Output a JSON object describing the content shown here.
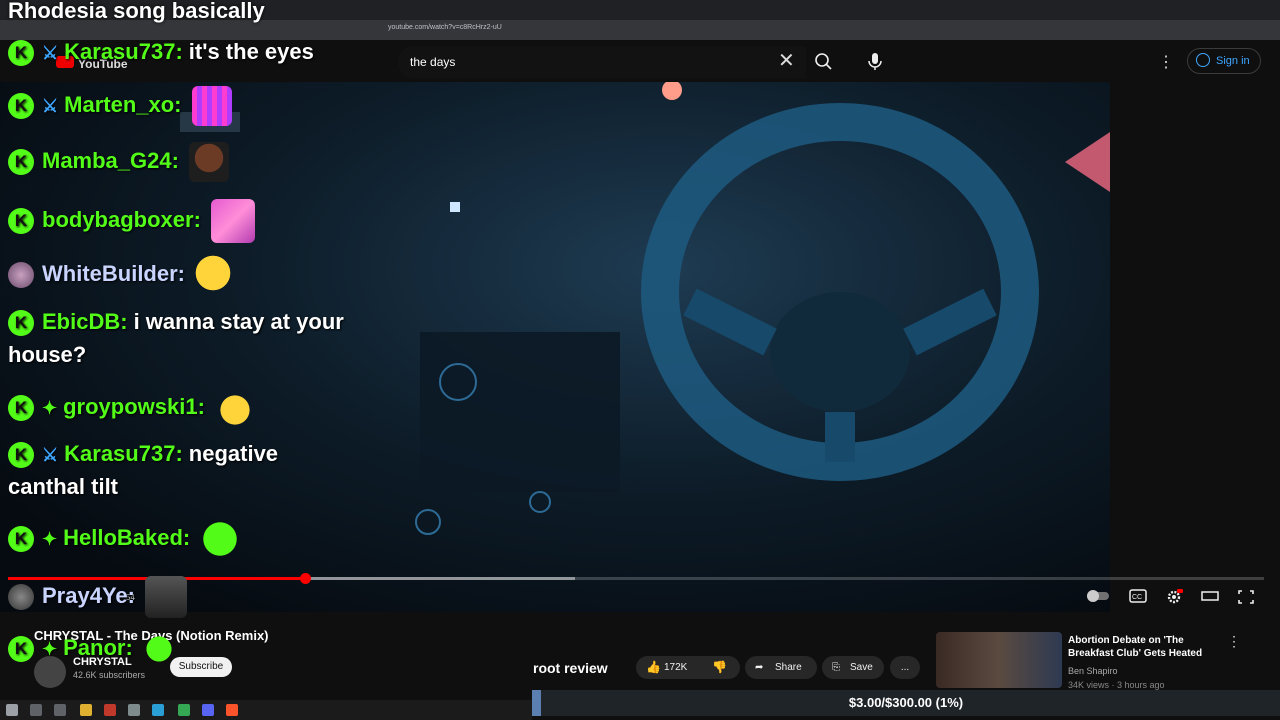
{
  "stream_title": "Rhodesia song basically",
  "browser": {
    "url": "youtube.com/watch?v=c8RcHrz2-uU"
  },
  "youtube": {
    "logo_text": "YouTube",
    "search_value": "the days",
    "signin_label": "Sign in",
    "video": {
      "title": "CHRYSTAL - The Days (Notion Remix)",
      "channel": "CHRYSTAL",
      "subscribers": "42.6K subscribers",
      "subscribe_label": "Subscribe",
      "likes": "172K",
      "share_label": "Share",
      "save_label": "Save",
      "more_label": "...",
      "progress_played_fraction": 0.236,
      "progress_buffered_fraction": 0.45,
      "time_fragment": "54"
    },
    "related": {
      "title": "Abortion Debate on 'The Breakfast Club' Gets Heated",
      "channel": "Ben Shapiro",
      "meta": "34K views · 3 hours ago"
    }
  },
  "chat": [
    {
      "user": "Karasu737:",
      "message": "it's the eyes",
      "badge": "sword"
    },
    {
      "user": "Marten_xo:",
      "message": "",
      "badge": "sword",
      "emote": "purple-grid-emote"
    },
    {
      "user": "Mamba_G24:",
      "message": "",
      "emote": "face-emote"
    },
    {
      "user": "bodybagboxer:",
      "message": "",
      "emote": "pink-emote"
    },
    {
      "user": "WhiteBuilder:",
      "message": "",
      "emote": "duck-emote"
    },
    {
      "user": "EbicDB:",
      "message": "i wanna stay at your",
      "message2": "house?"
    },
    {
      "user": "groypowski1:",
      "message": "",
      "badge": "diamond",
      "emote": "yellow-blob-emote"
    },
    {
      "user": "Karasu737:",
      "message": "negative",
      "message2": "canthal tilt",
      "badge": "sword"
    },
    {
      "user": "HelloBaked:",
      "message": "",
      "badge": "diamond",
      "emote": "green-smile-emote"
    },
    {
      "user": "Pray4Ye:",
      "message": "",
      "emote": "portrait-emote"
    },
    {
      "user": "Panor:",
      "message": "",
      "badge": "diamond",
      "emote": "green-smile-emote"
    }
  ],
  "overlay": {
    "root_review": "root review",
    "donation_text": "$3.00/$300.00 (1%)",
    "donation_fraction": 0.01
  },
  "colors": {
    "kick_green": "#53fc18",
    "yt_red": "#ff0000",
    "link_blue": "#3ea6ff"
  }
}
